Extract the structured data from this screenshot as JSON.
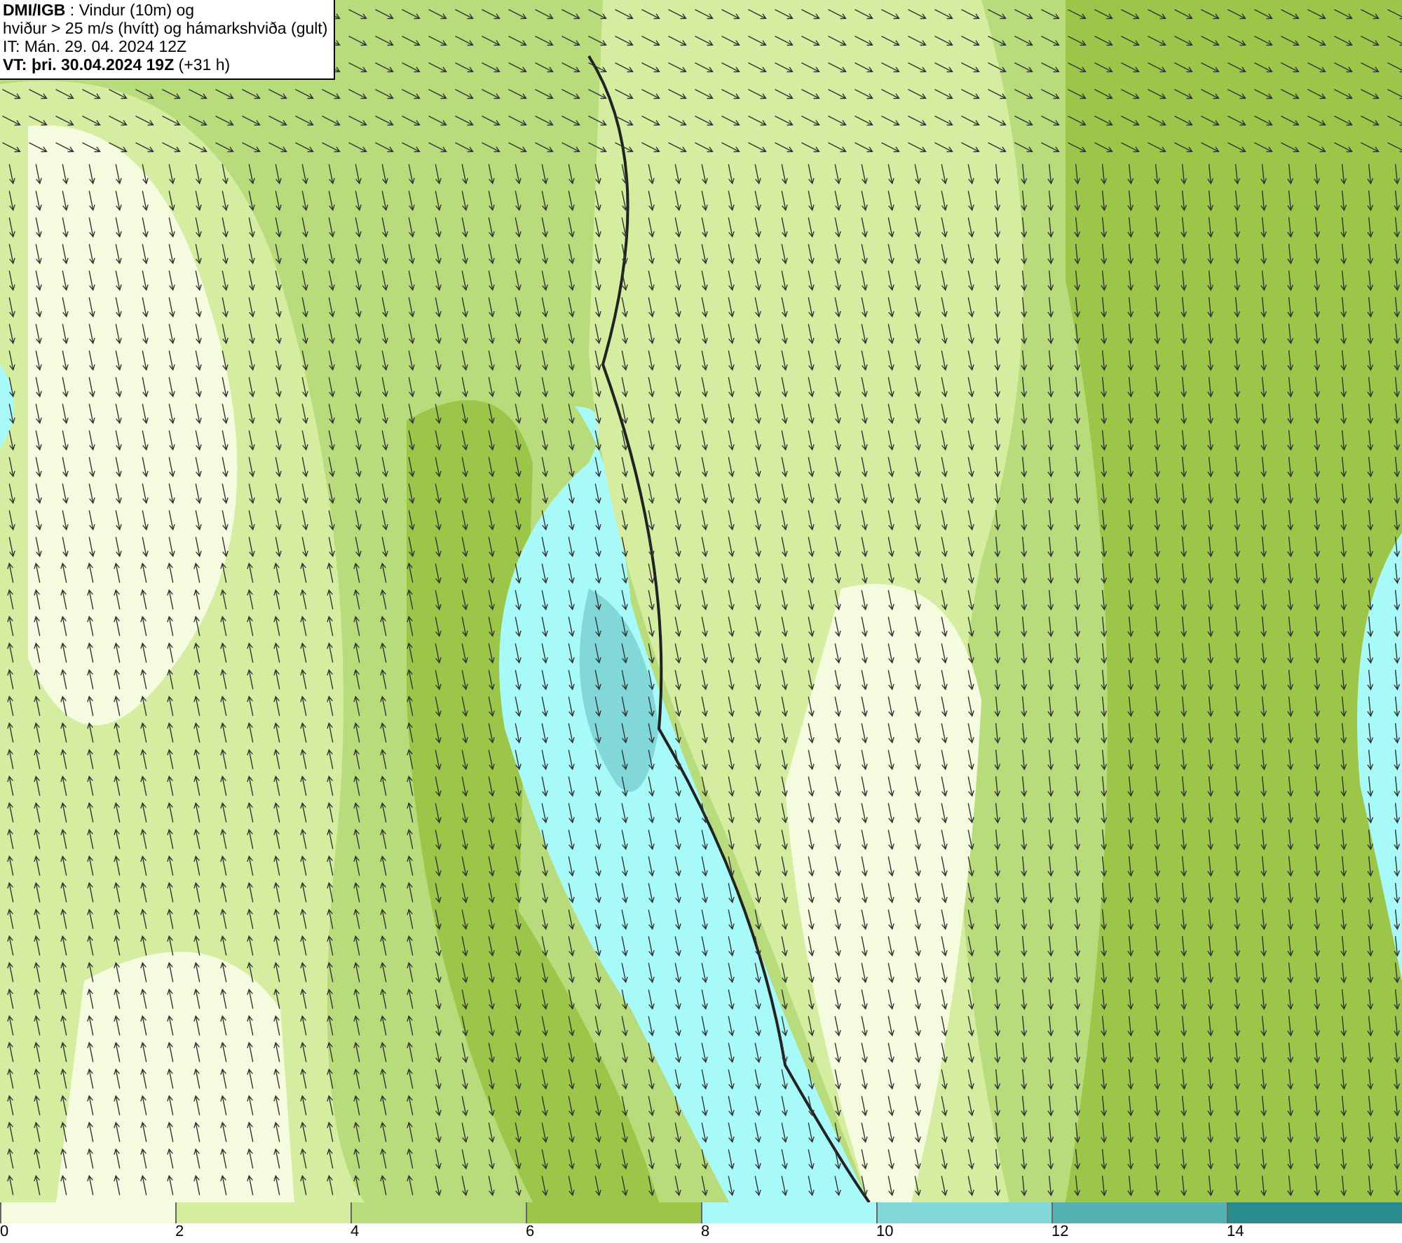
{
  "title_box": {
    "lines": [
      "**DMI/IGB** : Vindur (10m) og",
      "hviður > 25 m/s (hvítt) og hámarkshviða (gult)",
      "IT: Mán. 29. 04. 2024 12Z",
      "**VT: þri. 30.04.2024 19Z** (+31 h)"
    ]
  },
  "legend": [
    {
      "label": "0",
      "color": "#f4fbdf"
    },
    {
      "label": "2",
      "color": "#d4eda0"
    },
    {
      "label": "4",
      "color": "#b8dc7c"
    },
    {
      "label": "6",
      "color": "#9cc64a"
    },
    {
      "label": "8",
      "color": "#a8faf8"
    },
    {
      "label": "10",
      "color": "#82d8d8"
    },
    {
      "label": "12",
      "color": "#55b2b2"
    },
    {
      "label": "14",
      "color": "#2a8c8c"
    }
  ]
}
